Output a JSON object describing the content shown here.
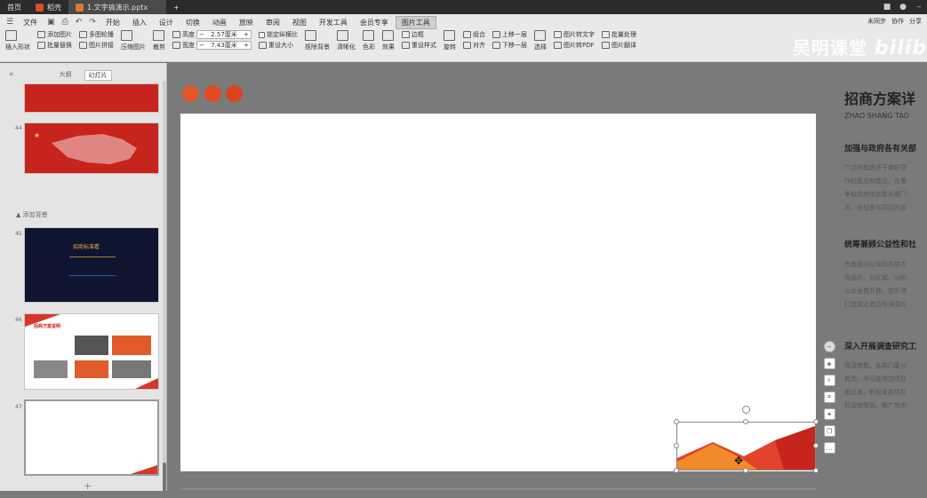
{
  "titlebar": {
    "tabs": [
      {
        "label": "首页",
        "color": ""
      },
      {
        "label": "稻壳",
        "color": "#e0492f"
      },
      {
        "label": "1.文字搞演示.pptx",
        "color": "#e0772f"
      }
    ],
    "new_tab": "+"
  },
  "ribbon": {
    "menu": [
      "文件",
      "开始",
      "插入",
      "设计",
      "切换",
      "动画",
      "放映",
      "审阅",
      "视图",
      "开发工具",
      "会员专享",
      "图片工具"
    ],
    "active_menu": "图片工具",
    "right_actions": [
      "未同步",
      "协作",
      "分享"
    ],
    "tools": {
      "insert_shape": "插入形状",
      "add_picture": "添加图片",
      "batch_replace": "批量替换",
      "multi_image": "多图轮播",
      "image_splice": "图片拼接",
      "compress": "压缩图片",
      "crop": "裁剪",
      "height_label": "高度",
      "height_value": "2.57厘米",
      "width_label": "宽度",
      "width_value": "7.43厘米",
      "lock_ratio": "锁定纵横比",
      "reset_size": "重设大小",
      "cutout": "抠除背景",
      "sharpen": "清晰化",
      "color": "色彩",
      "effects": "效果",
      "reset_style": "重设样式",
      "border": "边框",
      "rotate": "旋转",
      "group": "组合",
      "align": "对齐",
      "bring_forward": "上移一层",
      "send_backward": "下移一层",
      "select": "选择",
      "img_to_text": "图片转文字",
      "batch_process": "批量处理",
      "img_to_pdf": "图片转PDF",
      "img_translate": "图片翻译"
    }
  },
  "watermark": {
    "text": "吴明课堂",
    "logo": "bilibili"
  },
  "left_panel": {
    "tabs": [
      "大纲",
      "幻灯片"
    ],
    "active_tab": "幻灯片",
    "section_label": "添加背景",
    "slides": [
      {
        "num": "",
        "style": "red"
      },
      {
        "num": "44",
        "style": "red"
      },
      {
        "num": "45",
        "style": "dark"
      },
      {
        "num": "46",
        "style": "white"
      },
      {
        "num": "47",
        "style": "white"
      }
    ],
    "slide45_title": "招商标准看",
    "slide46_title": "招商方案说明"
  },
  "canvas": {
    "dot_colors": [
      "#e2562b",
      "#e04a24",
      "#d9431f"
    ],
    "right_title": "招商方案详",
    "right_subtitle": "ZHAO SHANG TAO",
    "sections": [
      {
        "heading": "加强与政府各有关部",
        "lines": [
          "广泛听取其关于做好项",
          "作的意见和建议，在重",
          "争取政府指定牵头部门",
          "员，全程参与项目的运"
        ]
      },
      {
        "heading": "统筹兼顾公益性和社",
        "lines": [
          "完善面向公众的开放方",
          "有组织、分区域、分阶",
          "公众免费开放，提升项",
          "打造成让老百姓满意的"
        ]
      },
      {
        "heading": "深入开展调查研究工",
        "lines": [
          "摸清底数，各部门要分",
          "其责。尽可能增加项目",
          "度出发，积极发掘项目",
          "好营销策划、推广和市"
        ]
      }
    ]
  },
  "float_tools": [
    "minus",
    "layers",
    "zoom",
    "crop",
    "bulb",
    "copy",
    "more"
  ]
}
